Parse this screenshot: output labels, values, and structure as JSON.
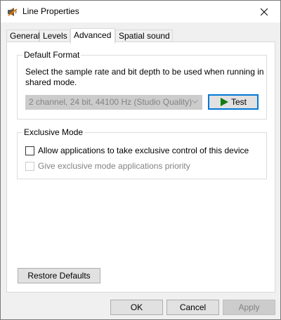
{
  "window": {
    "title": "Line Properties",
    "title_icon": "speaker-icon",
    "close_icon": "close-icon"
  },
  "tabs": [
    {
      "label": "General",
      "active": false
    },
    {
      "label": "Levels",
      "active": false
    },
    {
      "label": "Advanced",
      "active": true
    },
    {
      "label": "Spatial sound",
      "active": false
    }
  ],
  "default_format": {
    "legend": "Default Format",
    "description": "Select the sample rate and bit depth to be used when running in shared mode.",
    "selected_format": "2 channel, 24 bit, 44100 Hz (Studio Quality)",
    "format_disabled": true,
    "test_label": "Test",
    "test_icon": "play-icon",
    "test_icon_color": "#107c10"
  },
  "exclusive_mode": {
    "legend": "Exclusive Mode",
    "allow_label": "Allow applications to take exclusive control of this device",
    "allow_checked": false,
    "priority_label": "Give exclusive mode applications priority",
    "priority_checked": false,
    "priority_disabled": true
  },
  "restore_defaults_label": "Restore Defaults",
  "buttons": {
    "ok_label": "OK",
    "cancel_label": "Cancel",
    "apply_label": "Apply",
    "apply_disabled": true
  },
  "colors": {
    "focus_border": "#0078d7",
    "disabled_text": "#838383"
  }
}
